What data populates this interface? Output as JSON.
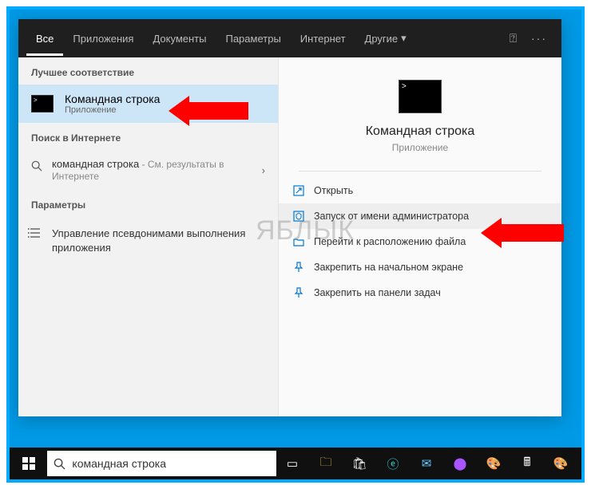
{
  "tabs": {
    "all": "Все",
    "apps": "Приложения",
    "docs": "Документы",
    "settings": "Параметры",
    "web": "Интернет",
    "more": "Другие"
  },
  "left": {
    "best_label": "Лучшее соответствие",
    "best_title": "Командная строка",
    "best_sub": "Приложение",
    "web_label": "Поиск в Интернете",
    "web_query": "командная строка",
    "web_sub": " - См. результаты в Интернете",
    "params_label": "Параметры",
    "param1": "Управление псевдонимами выполнения приложения"
  },
  "right": {
    "title": "Командная строка",
    "sub": "Приложение",
    "actions": {
      "open": "Открыть",
      "runadmin": "Запуск от имени администратора",
      "loc": "Перейти к расположению файла",
      "pinstart": "Закрепить на начальном экране",
      "pintask": "Закрепить на панели задач"
    }
  },
  "search": {
    "value": "командная строка"
  },
  "watermark": "ЯБЛЫК"
}
